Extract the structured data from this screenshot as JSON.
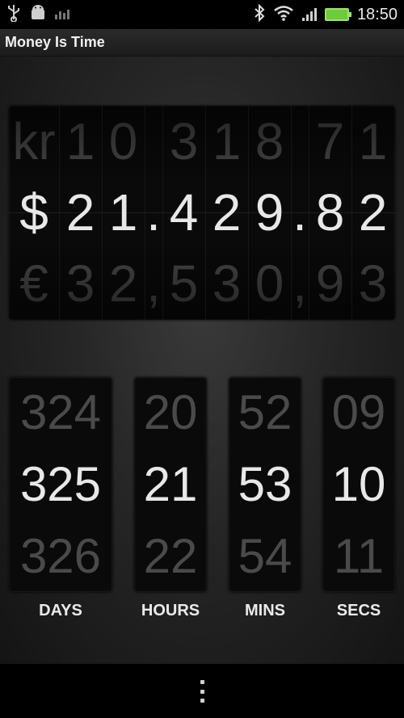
{
  "status_bar": {
    "time": "18:50",
    "icons": [
      "usb-icon",
      "android-debug-icon",
      "bars-icon",
      "bluetooth-icon",
      "wifi-icon",
      "signal-icon",
      "battery-icon"
    ]
  },
  "action_bar": {
    "title": "Money Is Time"
  },
  "money": {
    "top": [
      "kr",
      "1",
      "0",
      "",
      "3",
      "1",
      "8",
      "",
      "7",
      "1"
    ],
    "mid": [
      "$",
      "2",
      "1",
      ".",
      "4",
      "2",
      "9",
      ".",
      "8",
      "2"
    ],
    "bot": [
      "€",
      "3",
      "2",
      ",",
      "5",
      "3",
      "0",
      ",",
      "9",
      "3"
    ]
  },
  "timer": {
    "days": {
      "prev": "324",
      "current": "325",
      "next": "326",
      "label": "DAYS"
    },
    "hours": {
      "prev": "20",
      "current": "21",
      "next": "22",
      "label": "HOURS"
    },
    "mins": {
      "prev": "52",
      "current": "53",
      "next": "54",
      "label": "MINS"
    },
    "secs": {
      "prev": "09",
      "current": "10",
      "next": "11",
      "label": "SECS"
    }
  },
  "colors": {
    "bright_digit": "#e8e8e8",
    "dim_digit": "#4a4a4a",
    "battery": "#6ecb3a"
  }
}
